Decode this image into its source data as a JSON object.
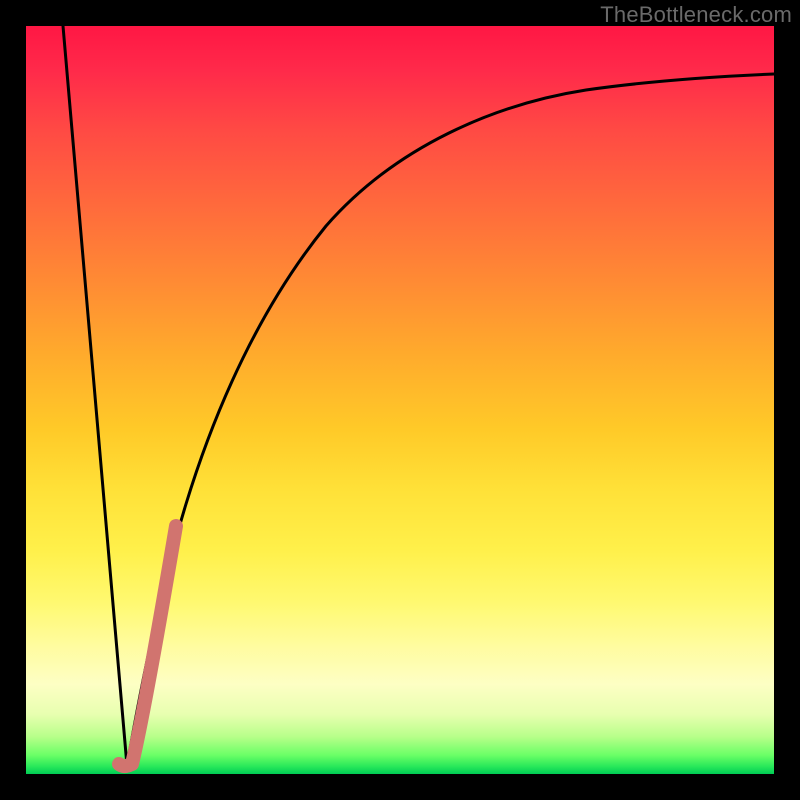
{
  "watermark": "TheBottleneck.com",
  "colors": {
    "curve_black": "#000000",
    "highlight_pink": "#d1746f",
    "frame": "#000000"
  },
  "chart_data": {
    "type": "line",
    "title": "",
    "xlabel": "",
    "ylabel": "",
    "xlim": [
      0,
      100
    ],
    "ylim": [
      0,
      100
    ],
    "grid": false,
    "legend": false,
    "series": [
      {
        "name": "left-descent",
        "color": "#000000",
        "x": [
          5,
          13.5
        ],
        "y": [
          100,
          1
        ]
      },
      {
        "name": "right-asymptote",
        "color": "#000000",
        "x": [
          13.5,
          15,
          17,
          19,
          20,
          22,
          24,
          26,
          30,
          35,
          40,
          45,
          50,
          55,
          60,
          70,
          80,
          90,
          100
        ],
        "y": [
          1,
          10,
          21,
          30,
          34,
          41,
          47,
          52,
          60,
          67,
          72,
          76,
          79,
          81.5,
          83.5,
          86.5,
          88.5,
          90,
          91
        ]
      },
      {
        "name": "highlight-segment",
        "color": "#d1746f",
        "x": [
          13.5,
          14,
          15,
          16,
          17,
          18,
          19,
          20
        ],
        "y": [
          1,
          4,
          10,
          16,
          21,
          26,
          30,
          34
        ]
      }
    ],
    "annotations": []
  }
}
